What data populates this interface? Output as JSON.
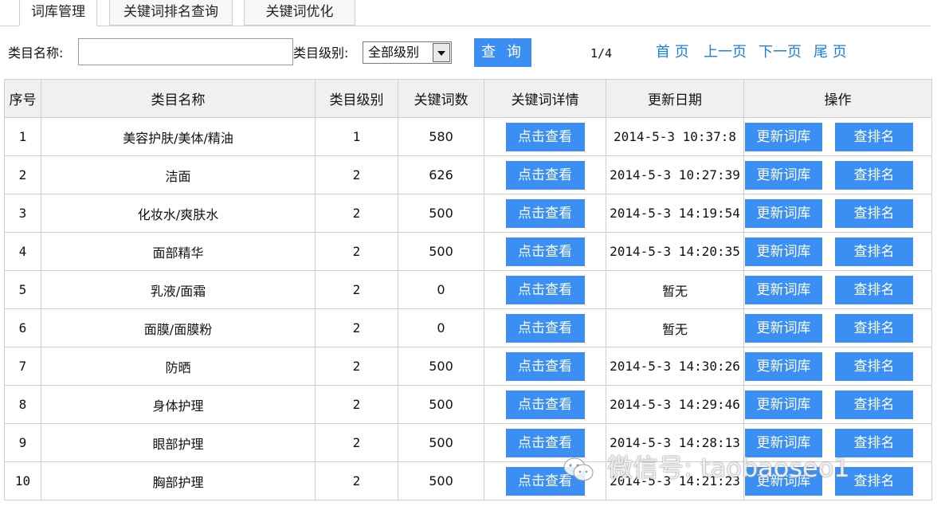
{
  "tabs": [
    {
      "label": "词库管理",
      "active": true
    },
    {
      "label": "关键词排名查询",
      "active": false
    },
    {
      "label": "关键词优化",
      "active": false
    }
  ],
  "search": {
    "name_label": "类目名称:",
    "name_value": "",
    "level_label": "类目级别:",
    "level_selected": "全部级别",
    "query_label": "查 询"
  },
  "pagination": {
    "current": "1/4",
    "first": "首 页",
    "prev": "上一页",
    "next": "下一页",
    "last": "尾 页"
  },
  "table": {
    "headers": [
      "序号",
      "类目名称",
      "类目级别",
      "关键词数",
      "关键词详情",
      "更新日期",
      "操作"
    ],
    "view_label": "点击查看",
    "update_label": "更新词库",
    "rank_label": "查排名",
    "rows": [
      {
        "no": "1",
        "name": "美容护肤/美体/精油",
        "level": "1",
        "count": "580",
        "date": "2014-5-3 10:37:8"
      },
      {
        "no": "2",
        "name": "洁面",
        "level": "2",
        "count": "626",
        "date": "2014-5-3 10:27:39"
      },
      {
        "no": "3",
        "name": "化妆水/爽肤水",
        "level": "2",
        "count": "500",
        "date": "2014-5-3 14:19:54"
      },
      {
        "no": "4",
        "name": "面部精华",
        "level": "2",
        "count": "500",
        "date": "2014-5-3 14:20:35"
      },
      {
        "no": "5",
        "name": "乳液/面霜",
        "level": "2",
        "count": "0",
        "date": "暂无"
      },
      {
        "no": "6",
        "name": "面膜/面膜粉",
        "level": "2",
        "count": "0",
        "date": "暂无"
      },
      {
        "no": "7",
        "name": "防晒",
        "level": "2",
        "count": "500",
        "date": "2014-5-3 14:30:26"
      },
      {
        "no": "8",
        "name": "身体护理",
        "level": "2",
        "count": "500",
        "date": "2014-5-3 14:29:46"
      },
      {
        "no": "9",
        "name": "眼部护理",
        "level": "2",
        "count": "500",
        "date": "2014-5-3 14:28:13"
      },
      {
        "no": "10",
        "name": "胸部护理",
        "level": "2",
        "count": "500",
        "date": "2014-5-3 14:21:23"
      }
    ]
  },
  "watermark": {
    "text": "微信号: taobaoseo1",
    "icon": "wechat-icon"
  },
  "colors": {
    "button": "#3b8ff3",
    "link": "#1a7fe6",
    "header_bg": "#f0f0f0",
    "border": "#cfcfcf"
  }
}
